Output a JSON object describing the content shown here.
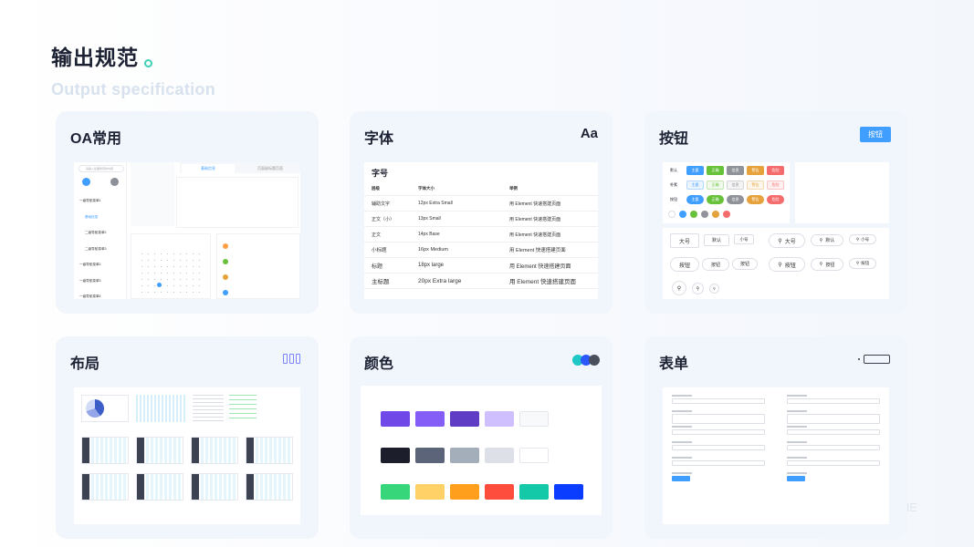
{
  "header": {
    "title": "输出规范",
    "subtitle": "Output specification"
  },
  "cards": {
    "oa": {
      "title": "OA常用"
    },
    "font": {
      "title": "字体",
      "icon_text": "Aa"
    },
    "button": {
      "title": "按钮",
      "sample_label": "按钮"
    },
    "layout": {
      "title": "布局"
    },
    "color": {
      "title": "颜色"
    },
    "form": {
      "title": "表单"
    }
  },
  "font_table": {
    "heading": "字号",
    "columns": [
      "层级",
      "字体大小",
      "举例"
    ],
    "rows": [
      [
        "辅助文字",
        "12px Extra Small",
        "用 Element 快速搭建页面"
      ],
      [
        "正文（小）",
        "13px Small",
        "用 Element 快速搭建页面"
      ],
      [
        "正文",
        "14px Base",
        "用 Element 快速搭建页面"
      ],
      [
        "小标题",
        "16px Medium",
        "用 Element 快速搭建页面"
      ],
      [
        "标题",
        "18px large",
        "用 Element 快速搭建页面"
      ],
      [
        "主标题",
        "20px Extra large",
        "用 Element 快速搭建页面"
      ]
    ]
  },
  "button_preview": {
    "row_labels": [
      "默认",
      "朴素",
      "按钮"
    ],
    "type_labels": [
      "主要",
      "正确",
      "信息",
      "警告",
      "危险"
    ],
    "size_labels": [
      "大号",
      "默认",
      "小号"
    ],
    "plain_label": "按钮"
  },
  "oa_preview": {
    "search_placeholder": "请输入您要搜索的内容",
    "menu_items": [
      "一级导航菜单1",
      "基础信息",
      "二级导航菜单2",
      "二级导航菜单3",
      "一级导航菜单2",
      "一级导航菜单3",
      "一级导航菜单4"
    ],
    "tabs": [
      "基础信息",
      "页面级标题页面"
    ]
  },
  "colors": {
    "brand": [
      "#7048e8",
      "#845ef7",
      "#5f3dc4",
      "#d0bfff",
      "#f8f9fa"
    ],
    "neutral": [
      "#1c1f2b",
      "#5b6478",
      "#a4adba",
      "#dde1e7",
      "#ffffff"
    ],
    "function": [
      "#37d67a",
      "#ffd166",
      "#ff9f1c",
      "#ff4d3d",
      "#14c9a8",
      "#0a3dff"
    ],
    "icon_dots": [
      "#1fc7c7",
      "#2b59ff",
      "#4a4f5c"
    ],
    "accent": "#409eff"
  },
  "watermark": "IE"
}
